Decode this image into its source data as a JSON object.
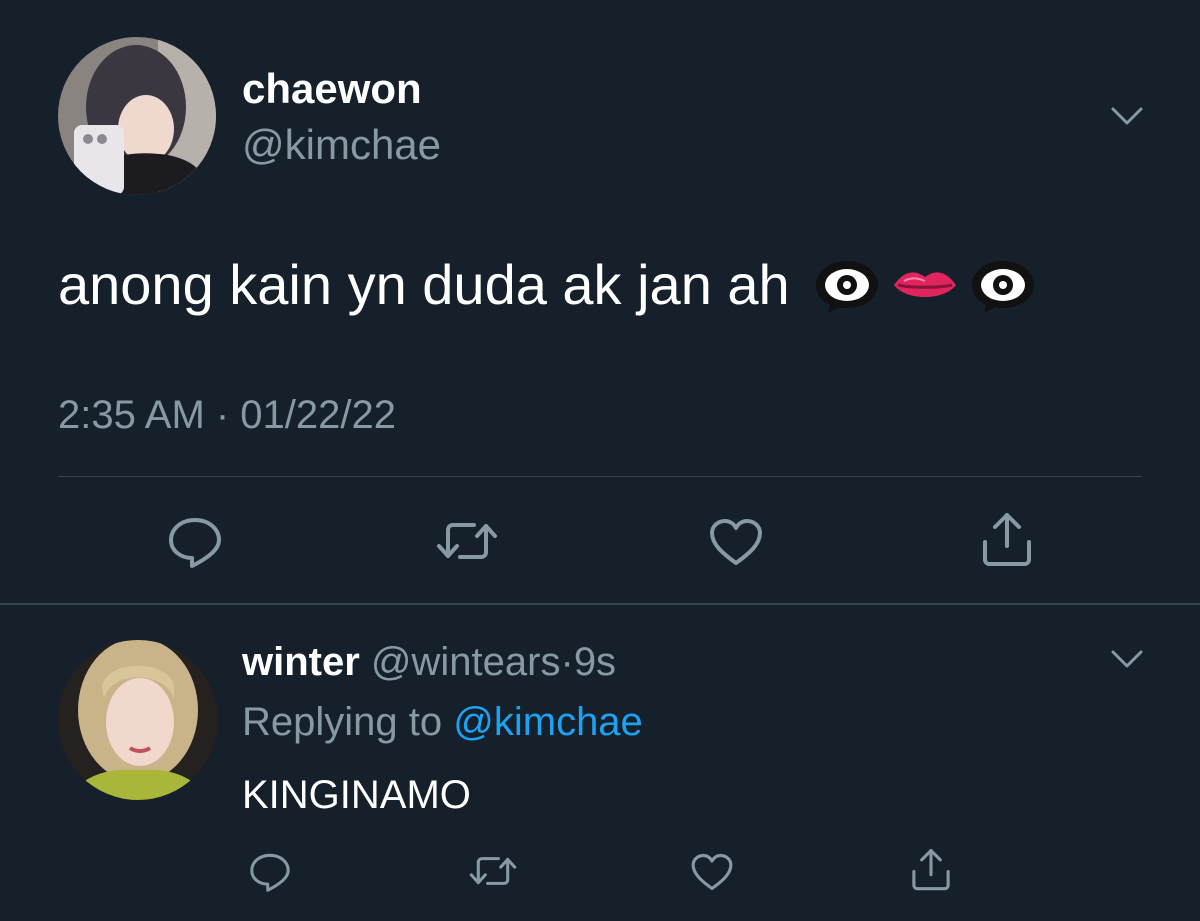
{
  "main_tweet": {
    "display_name": "chaewon",
    "handle": "@kimchae",
    "text": "anong kain yn duda ak jan ah",
    "emojis": [
      "eye-in-speech-bubble",
      "lips",
      "eye-in-speech-bubble"
    ],
    "timestamp": "2:35 AM · 01/22/22",
    "actions": [
      "reply-icon",
      "retweet-icon",
      "like-icon",
      "share-icon"
    ]
  },
  "reply": {
    "display_name": "winter",
    "handle": "@wintears",
    "separator": "·",
    "time_ago": "9s",
    "replying_prefix": "Replying to",
    "replying_to": "@kimchae",
    "text": "KINGINAMO",
    "actions": [
      "reply-icon",
      "retweet-icon",
      "like-icon",
      "share-icon"
    ]
  },
  "colors": {
    "background": "#15202b",
    "secondary_text": "#8899a6",
    "accent": "#1da1f2",
    "divider": "#38444d"
  }
}
